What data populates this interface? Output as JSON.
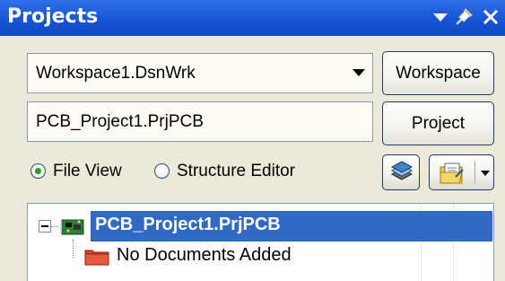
{
  "panel": {
    "title": "Projects"
  },
  "workspace": {
    "selected": "Workspace1.DsnWrk",
    "button_label": "Workspace"
  },
  "project": {
    "value": "PCB_Project1.PrjPCB",
    "button_label": "Project"
  },
  "view_options": [
    {
      "label": "File View",
      "selected": true
    },
    {
      "label": "Structure Editor",
      "selected": false
    }
  ],
  "tree": {
    "project_node": "PCB_Project1.PrjPCB",
    "child_node": "No Documents Added"
  },
  "colors": {
    "titlebar": "#1655d6",
    "selection": "#316ac5",
    "radio_dot": "#21a121",
    "folder": "#e0452a"
  }
}
